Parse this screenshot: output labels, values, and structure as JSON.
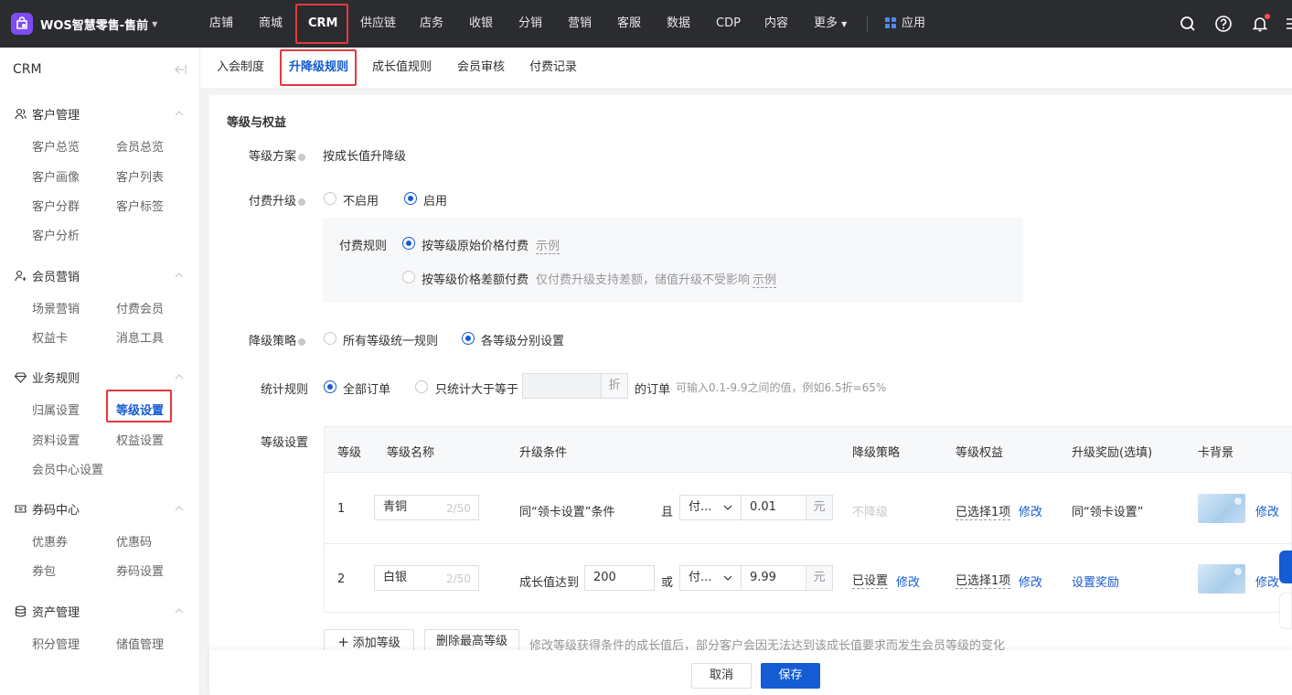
{
  "app": {
    "name": "WOS智慧零售-售前"
  },
  "topnav": {
    "items": [
      "店铺",
      "商城",
      "CRM",
      "供应链",
      "店务",
      "收银",
      "分销",
      "营销",
      "客服",
      "数据",
      "CDP",
      "内容",
      "更多"
    ],
    "active": "CRM",
    "apps_label": "应用"
  },
  "sidebar": {
    "title": "CRM",
    "groups": [
      {
        "label": "客户管理",
        "items": [
          "客户总览",
          "会员总览",
          "客户画像",
          "客户列表",
          "客户分群",
          "客户标签",
          "客户分析"
        ]
      },
      {
        "label": "会员营销",
        "items": [
          "场景营销",
          "付费会员",
          "权益卡",
          "消息工具"
        ]
      },
      {
        "label": "业务规则",
        "items": [
          "归属设置",
          "等级设置",
          "资料设置",
          "权益设置",
          "会员中心设置"
        ]
      },
      {
        "label": "券码中心",
        "items": [
          "优惠券",
          "优惠码",
          "券包",
          "券码设置"
        ]
      },
      {
        "label": "资产管理",
        "items": [
          "积分管理",
          "储值管理"
        ]
      }
    ],
    "active_item": "等级设置"
  },
  "subtabs": {
    "items": [
      "入会制度",
      "升降级规则",
      "成长值规则",
      "会员审核",
      "付费记录"
    ],
    "active": "升降级规则"
  },
  "form": {
    "section_title": "等级与权益",
    "scheme": {
      "label": "等级方案",
      "value": "按成长值升降级"
    },
    "paid_upgrade": {
      "label": "付费升级",
      "options": [
        "不启用",
        "启用"
      ],
      "selected": "启用"
    },
    "paid_rule": {
      "label": "付费规则",
      "option1": "按等级原始价格付费",
      "option2": "按等级价格差额付费",
      "option2_note": "仅付费升级支持差额，储值升级不受影响",
      "example": "示例",
      "selected": "按等级原始价格付费"
    },
    "downgrade": {
      "label": "降级策略",
      "options": [
        "所有等级统一规则",
        "各等级分别设置"
      ],
      "selected": "各等级分别设置"
    },
    "stats_rule": {
      "label": "统计规则",
      "option1": "全部订单",
      "option2": "只统计大于等于",
      "discount_placeholder": "",
      "discount_unit": "折",
      "suffix": "的订单",
      "hint": "可输入0.1-9.9之间的值，例如6.5折=65%",
      "selected": "全部订单"
    },
    "level_settings_label": "等级设置"
  },
  "table": {
    "headers": [
      "等级",
      "等级名称",
      "升级条件",
      "降级策略",
      "等级权益",
      "升级奖励(选填)",
      "卡背景"
    ],
    "rows": [
      {
        "level": "1",
        "name": "青铜",
        "name_count": "2/50",
        "cond_text": "同“领卡设置”条件",
        "conj": "且",
        "select": "付...",
        "amount": "0.01",
        "unit": "元",
        "downgrade": "不降级",
        "benefits": "已选择1项",
        "benefits_link": "修改",
        "reward": "同“领卡设置”",
        "card_link": "修改"
      },
      {
        "level": "2",
        "name": "白银",
        "name_count": "2/50",
        "cond_text": "成长值达到",
        "growth": "200",
        "conj": "或",
        "select": "付...",
        "amount": "9.99",
        "unit": "元",
        "downgrade": "已设置",
        "downgrade_link": "修改",
        "benefits": "已选择1项",
        "benefits_link": "修改",
        "reward": "设置奖励",
        "card_link": "修改"
      }
    ]
  },
  "actions": {
    "add_level": "添加等级",
    "delete_top": "删除最高等级",
    "warning": "修改等级获得条件的成长值后，部分客户会因无法达到该成长值要求而发生会员等级的变化"
  },
  "footer": {
    "cancel": "取消",
    "save": "保存"
  },
  "colors": {
    "primary": "#155bd4",
    "topbar": "#2b2c30",
    "brand": "#7d4cf5",
    "highlight": "#e4393c"
  }
}
